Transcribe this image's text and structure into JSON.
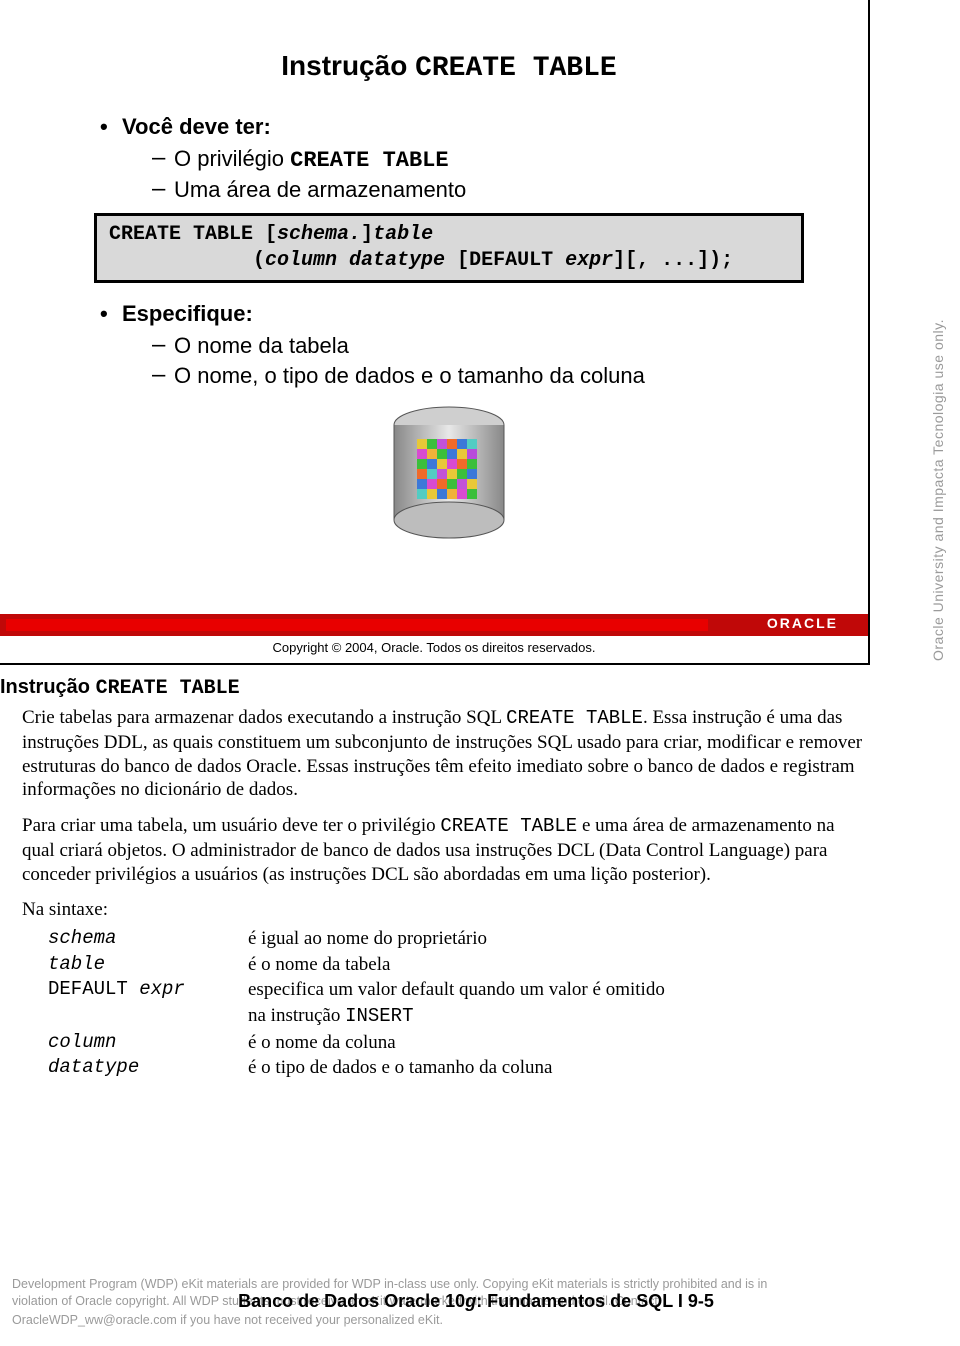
{
  "slide": {
    "title_prefix": "Instrução ",
    "title_mono": "CREATE TABLE",
    "b1": "Você deve ter:",
    "b1a_pre": "O privilégio ",
    "b1a_mono": "CREATE TABLE",
    "b1b": "Uma área de armazenamento",
    "code_l1_a": "CREATE TABLE [",
    "code_l1_b": "schema.",
    "code_l1_c": "]",
    "code_l1_d": "table",
    "code_l2_a": "            (",
    "code_l2_b": "column datatype ",
    "code_l2_c": "[DEFAULT ",
    "code_l2_d": "expr",
    "code_l2_e": "][, ...]);",
    "b2": "Especifique:",
    "b2a": "O nome da tabela",
    "b2b": "O nome, o tipo de dados e o tamanho da coluna",
    "oracle_logo": "ORACLE",
    "copyright": "Copyright © 2004, Oracle. Todos os direitos reservados."
  },
  "body": {
    "heading_pre": "Instrução ",
    "heading_mono": "CREATE TABLE",
    "p1_a": "Crie tabelas para armazenar dados executando a instrução SQL ",
    "p1_m1": "CREATE TABLE",
    "p1_b": ". Essa instrução é uma das instruções DDL, as quais constituem um subconjunto de instruções SQL usado para criar, modificar e remover estruturas do banco de dados Oracle. Essas instruções têm efeito imediato sobre o banco de dados e registram informações no dicionário de dados.",
    "p2_a": "Para criar uma tabela, um usuário deve ter o privilégio ",
    "p2_m1": "CREATE TABLE",
    "p2_b": " e uma área de armazenamento na qual criará objetos. O administrador de banco de dados usa instruções DCL (Data Control Language) para conceder privilégios a usuários (as instruções DCL são abordadas em uma lição posterior).",
    "p3": "Na sintaxe:",
    "syntax": [
      {
        "k": "schema",
        "ktype": "ital",
        "v": "é igual ao nome do proprietário"
      },
      {
        "k": "table",
        "ktype": "ital",
        "v": "é o nome da tabela"
      },
      {
        "k": "DEFAULT expr",
        "ktype": "mix",
        "v": "especifica um valor default quando um valor é omitido na instrução INSERT"
      },
      {
        "k": "column",
        "ktype": "ital",
        "v": "é o nome da coluna"
      },
      {
        "k": "datatype",
        "ktype": "ital",
        "v": "é o tipo de dados e o tamanho da coluna"
      }
    ]
  },
  "side_note": "Oracle University and Impacta Tecnologia use only.",
  "footer": {
    "fine1": "Development Program (WDP) eKit materials are provided for WDP in-class use only. Copying eKit materials is strictly prohibited and is in",
    "fine2": "violation of Oracle copyright. All WDP students must receive an eKit watermarked with their name and email. Contact",
    "fine3": "OracleWDP_ww@oracle.com if you have not received your personalized eKit.",
    "title_a": "Banco de Dados Oracle 10",
    "title_g": "g",
    "title_b": ": Fundamentos de SQL I   9-5"
  }
}
